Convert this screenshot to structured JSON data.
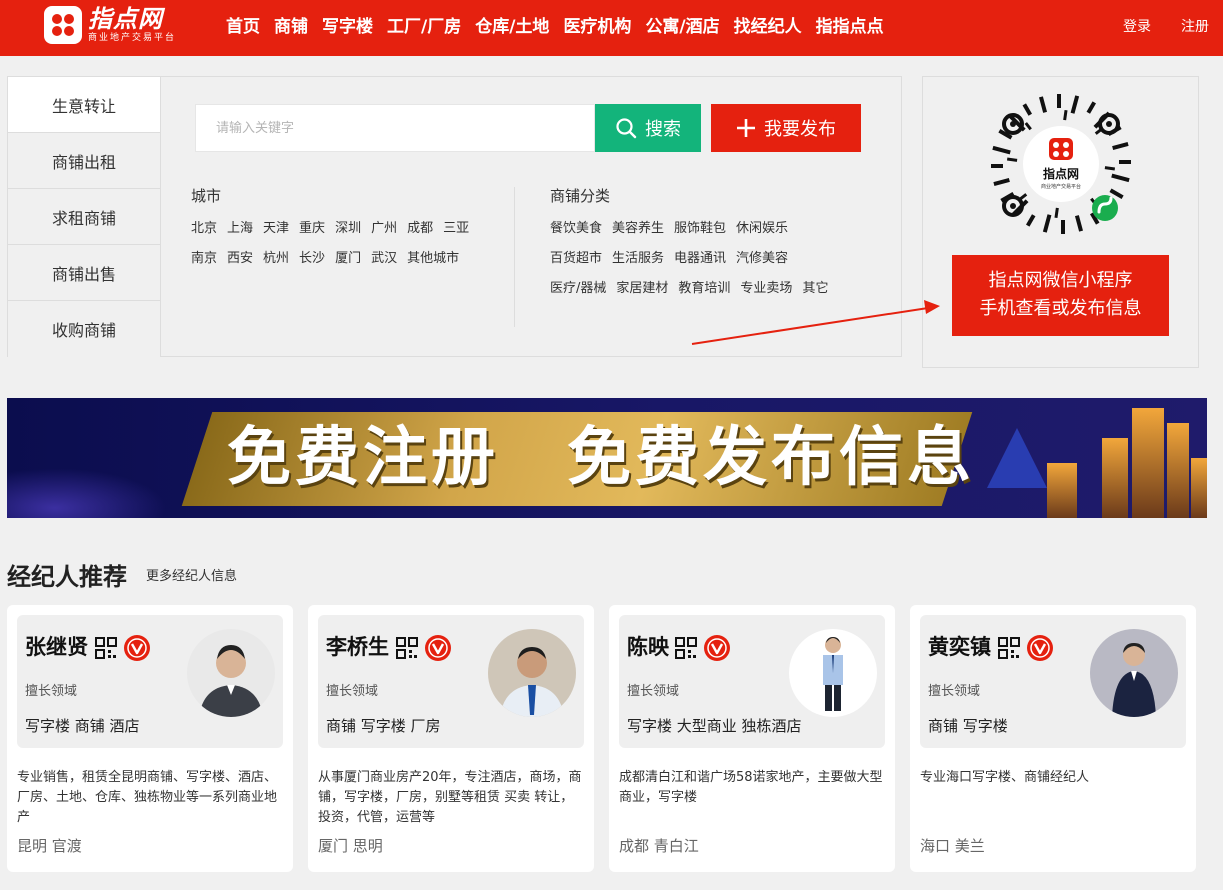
{
  "header": {
    "logo": {
      "name": "指点网",
      "slogan": "商业地产交易平台"
    },
    "nav": [
      "首页",
      "商铺",
      "写字楼",
      "工厂/厂房",
      "仓库/土地",
      "医疗机构",
      "公寓/酒店",
      "找经纪人",
      "指指点点"
    ],
    "login": "登录",
    "register": "注册"
  },
  "search": {
    "tabs": [
      "生意转让",
      "商铺出租",
      "求租商铺",
      "商铺出售",
      "收购商铺"
    ],
    "active_tab": 0,
    "placeholder": "请输入关键字",
    "search_label": "搜索",
    "publish_label": "我要发布",
    "city_title": "城市",
    "cities": [
      "北京",
      "上海",
      "天津",
      "重庆",
      "深圳",
      "广州",
      "成都",
      "三亚",
      "南京",
      "西安",
      "杭州",
      "长沙",
      "厦门",
      "武汉",
      "其他城市"
    ],
    "category_title": "商铺分类",
    "categories": [
      "餐饮美食",
      "美容养生",
      "服饰鞋包",
      "休闲娱乐",
      "百货超市",
      "生活服务",
      "电器通讯",
      "汽修美容",
      "医疗/器械",
      "家居建材",
      "教育培训",
      "专业卖场",
      "其它"
    ]
  },
  "promo": {
    "line1": "指点网微信小程序",
    "line2": "手机查看或发布信息",
    "qr_logo_text": "指点网",
    "qr_logo_sub": "商业地产交易平台"
  },
  "banner": {
    "text": "免费注册　免费发布信息"
  },
  "agents_section": {
    "title": "经纪人推荐",
    "more": "更多经纪人信息",
    "specialty_label": "擅长领域",
    "agents": [
      {
        "name": "张继贤",
        "specialty": "写字楼 商铺 酒店",
        "bio": "专业销售，租赁全昆明商铺、写字楼、酒店、厂房、土地、仓库、独栋物业等一系列商业地产",
        "location": "昆明 官渡"
      },
      {
        "name": "李桥生",
        "specialty": "商铺 写字楼 厂房",
        "bio": "从事厦门商业房产20年，专注酒店，商场，商铺，写字楼，厂房，别墅等租赁 买卖 转让，投资，代管，运营等",
        "location": "厦门 思明"
      },
      {
        "name": "陈映",
        "specialty": "写字楼 大型商业 独栋酒店",
        "bio": "成都清白江和谐广场58诺家地产，主要做大型商业，写字楼",
        "location": "成都 青白江"
      },
      {
        "name": "黄奕镇",
        "specialty": "商铺 写字楼",
        "bio": "专业海口写字楼、商铺经纪人",
        "location": "海口 美兰"
      }
    ]
  },
  "colors": {
    "brand_red": "#e5210f",
    "search_green": "#13b47b",
    "page_bg": "#f0f0f0"
  }
}
